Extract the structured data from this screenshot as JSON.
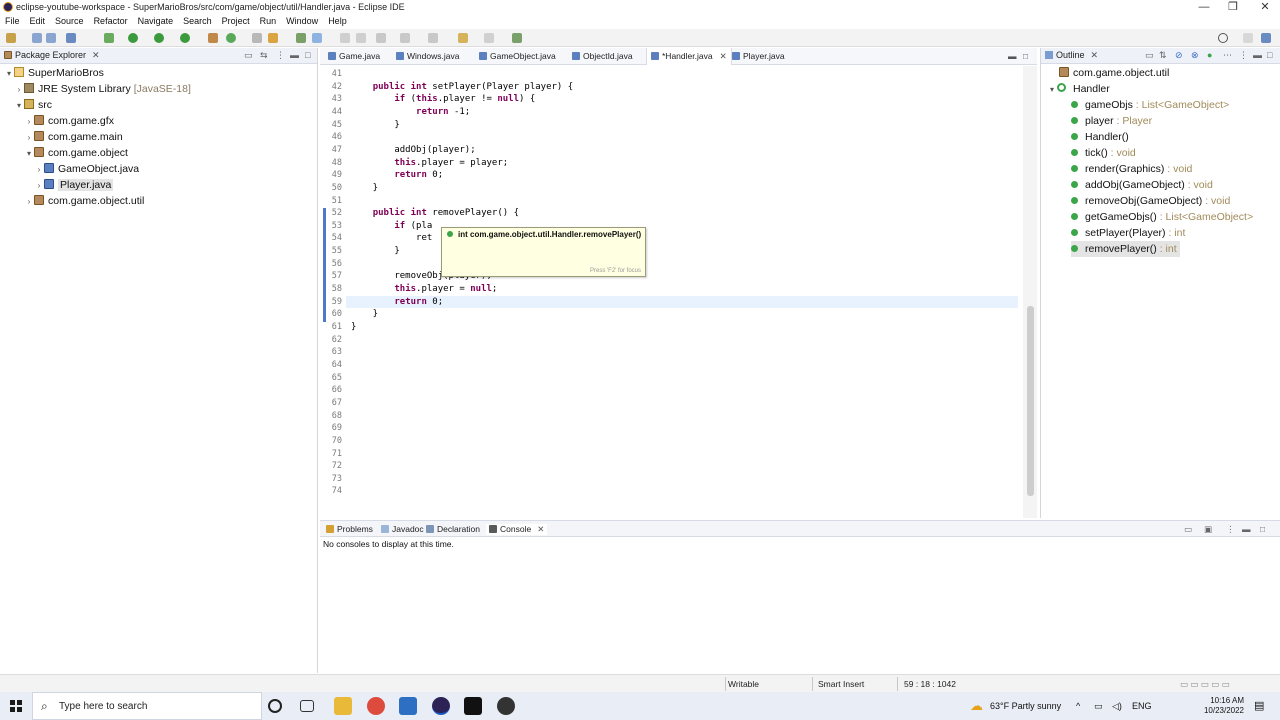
{
  "window": {
    "title": "eclipse-youtube-workspace - SuperMarioBros/src/com/game/object/util/Handler.java - Eclipse IDE",
    "minimize": "—",
    "maximize": "❐",
    "close": "✕"
  },
  "menu": [
    "File",
    "Edit",
    "Source",
    "Refactor",
    "Navigate",
    "Search",
    "Project",
    "Run",
    "Window",
    "Help"
  ],
  "package_explorer": {
    "tab_label": "Package Explorer",
    "tree": [
      {
        "label": "SuperMarioBros",
        "twisty": "▾",
        "icon": "project-icon"
      },
      {
        "label": "JRE System Library",
        "suffix": "[JavaSE-18]",
        "twisty": "›",
        "icon": "library-icon"
      },
      {
        "label": "src",
        "twisty": "▾",
        "icon": "source-folder-icon"
      },
      {
        "label": "com.game.gfx",
        "twisty": "›",
        "icon": "package-icon"
      },
      {
        "label": "com.game.main",
        "twisty": "›",
        "icon": "package-icon"
      },
      {
        "label": "com.game.object",
        "twisty": "▾",
        "icon": "package-icon"
      },
      {
        "label": "GameObject.java",
        "twisty": "›",
        "icon": "java-file-icon"
      },
      {
        "label": "Player.java",
        "twisty": "›",
        "icon": "java-file-icon"
      },
      {
        "label": "com.game.object.util",
        "twisty": "›",
        "icon": "package-icon"
      }
    ]
  },
  "editor": {
    "tabs": [
      "Game.java",
      "Windows.java",
      "GameObject.java",
      "ObjectId.java",
      "*Handler.java",
      "Player.java"
    ],
    "active_tab": "*Handler.java",
    "lines": [
      {
        "n": "41",
        "text": ""
      },
      {
        "n": "42",
        "text": "    public int setPlayer(Player player) {"
      },
      {
        "n": "43",
        "text": "        if (this.player != null) {"
      },
      {
        "n": "44",
        "text": "            return -1;"
      },
      {
        "n": "45",
        "text": "        }"
      },
      {
        "n": "46",
        "text": ""
      },
      {
        "n": "47",
        "text": "        addObj(player);"
      },
      {
        "n": "48",
        "text": "        this.player = player;"
      },
      {
        "n": "49",
        "text": "        return 0;"
      },
      {
        "n": "50",
        "text": "    }"
      },
      {
        "n": "51",
        "text": ""
      },
      {
        "n": "52",
        "text": "    public int removePlayer() {"
      },
      {
        "n": "53",
        "text": "        if (pla"
      },
      {
        "n": "54",
        "text": "            ret"
      },
      {
        "n": "55",
        "text": "        }"
      },
      {
        "n": "56",
        "text": ""
      },
      {
        "n": "57",
        "text": "        removeObj(player);"
      },
      {
        "n": "58",
        "text": "        this.player = null;"
      },
      {
        "n": "59",
        "text": "        return 0;"
      },
      {
        "n": "60",
        "text": "    }"
      },
      {
        "n": "61",
        "text": "}"
      },
      {
        "n": "62",
        "text": ""
      },
      {
        "n": "63",
        "text": ""
      },
      {
        "n": "64",
        "text": ""
      },
      {
        "n": "65",
        "text": ""
      },
      {
        "n": "66",
        "text": ""
      },
      {
        "n": "67",
        "text": ""
      },
      {
        "n": "68",
        "text": ""
      },
      {
        "n": "69",
        "text": ""
      },
      {
        "n": "70",
        "text": ""
      },
      {
        "n": "71",
        "text": ""
      },
      {
        "n": "72",
        "text": ""
      },
      {
        "n": "73",
        "text": ""
      },
      {
        "n": "74",
        "text": ""
      }
    ],
    "hover_tooltip": {
      "signature": "int com.game.object.util.Handler.removePlayer()",
      "hint": "Press 'F2' for focus"
    }
  },
  "outline": {
    "tab_label": "Outline",
    "package": "com.game.object.util",
    "class": "Handler",
    "members": [
      {
        "name": "gameObjs",
        "type": " : List<GameObject>"
      },
      {
        "name": "player",
        "type": " : Player"
      },
      {
        "name": "Handler()",
        "type": ""
      },
      {
        "name": "tick()",
        "type": " : void"
      },
      {
        "name": "render(Graphics)",
        "type": " : void"
      },
      {
        "name": "addObj(GameObject)",
        "type": " : void"
      },
      {
        "name": "removeObj(GameObject)",
        "type": " : void"
      },
      {
        "name": "getGameObjs()",
        "type": " : List<GameObject>"
      },
      {
        "name": "setPlayer(Player)",
        "type": " : int"
      },
      {
        "name": "removePlayer()",
        "type": " : int"
      }
    ]
  },
  "console": {
    "tabs": [
      "Problems",
      "Javadoc",
      "Declaration",
      "Console"
    ],
    "active_tab": "Console",
    "message": "No consoles to display at this time."
  },
  "status": {
    "writable": "Writable",
    "insert_mode": "Smart Insert",
    "position": "59 : 18 : 1042"
  },
  "taskbar": {
    "search_placeholder": "Type here to search",
    "weather": "63°F  Partly sunny",
    "language": "ENG",
    "time": "10:16 AM",
    "date": "10/23/2022"
  }
}
